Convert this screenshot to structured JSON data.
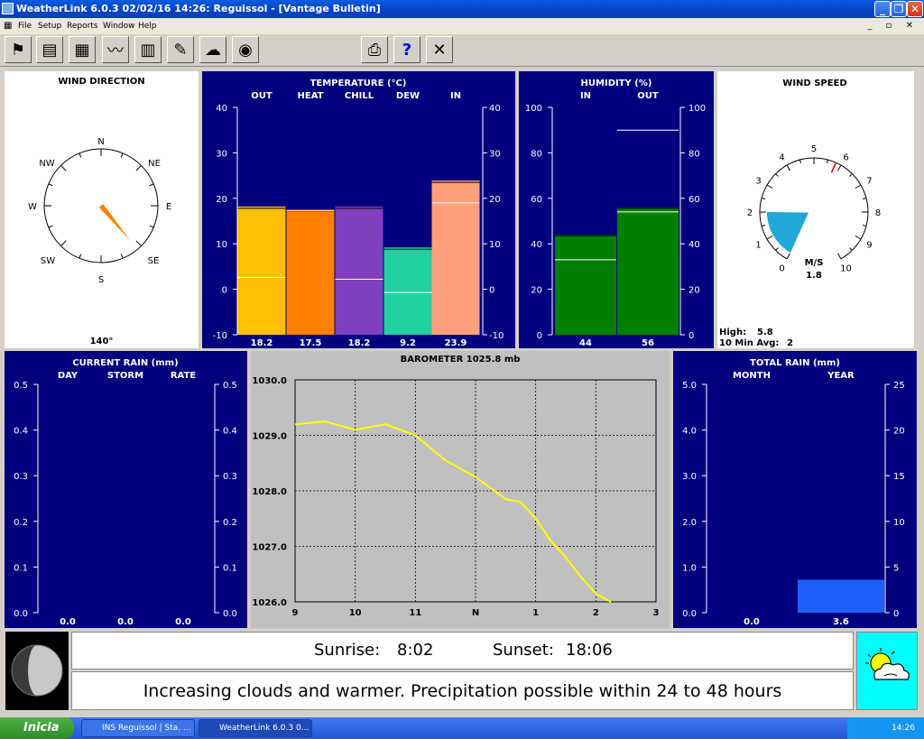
{
  "window": {
    "title": "WeatherLink 6.0.3  02/02/16  14:26: Reguissol - [Vantage Bulletin]"
  },
  "menu": [
    "File",
    "Setup",
    "Reports",
    "Window",
    "Help"
  ],
  "mdi_controls": "_ ▫ ✕",
  "toolbar": {
    "icons": [
      "bulletin-icon",
      "console-icon",
      "summary-icon",
      "graph-icon",
      "strip-chart-icon",
      "notes-icon",
      "weather-icon",
      "noaa-icon",
      "print-icon",
      "help-icon",
      "close-icon"
    ]
  },
  "wind_direction": {
    "title": "WIND DIRECTION",
    "degrees": 140,
    "degrees_label": "140°",
    "labels": [
      "N",
      "NE",
      "E",
      "SE",
      "S",
      "SW",
      "W",
      "NW"
    ],
    "needle_color": "#ff7f00"
  },
  "temperature": {
    "title": "TEMPERATURE  (°C)",
    "columns": [
      "OUT",
      "HEAT",
      "CHILL",
      "DEW",
      "IN"
    ],
    "values": [
      18.2,
      17.5,
      18.2,
      9.2,
      23.9
    ],
    "value_labels": [
      "18.2",
      "17.5",
      "18.2",
      "9.2",
      "23.9"
    ],
    "low_marks": [
      2.6,
      17.2,
      2.2,
      -0.7,
      19.0
    ],
    "colors": [
      "#ffc000",
      "#ff7f00",
      "#7f3fbf",
      "#20d0a0",
      "#ffa07a"
    ],
    "ticks": [
      "40",
      "30",
      "20",
      "10",
      "0",
      "-10"
    ],
    "ylim": [
      -10,
      40
    ]
  },
  "humidity": {
    "title": "HUMIDITY  (%)",
    "columns": [
      "IN",
      "OUT"
    ],
    "values": [
      44,
      56
    ],
    "value_labels": [
      "44",
      "56"
    ],
    "low_marks": [
      33,
      54
    ],
    "high_marks": [
      null,
      90
    ],
    "color": "#007f00",
    "ticks": [
      "100",
      "80",
      "60",
      "40",
      "20",
      "0"
    ],
    "ylim": [
      0,
      100
    ]
  },
  "wind_speed": {
    "title": "WIND SPEED",
    "unit": "M/S",
    "value": 1.8,
    "value_label": "1.8",
    "ticks": [
      "0",
      "1",
      "2",
      "3",
      "4",
      "5",
      "6",
      "7",
      "8",
      "9",
      "10"
    ],
    "high_label": "High:",
    "high_value": "5.8",
    "avg_label": "10 Min Avg:",
    "avg_value": "2",
    "range_low": 0.0,
    "range_high": 2.0,
    "red_mark": 5.8,
    "fill_color": "#1fa8d8"
  },
  "current_rain": {
    "title": "CURRENT RAIN  (mm)",
    "columns": [
      "DAY",
      "STORM",
      "RATE"
    ],
    "values": [
      "0.0",
      "0.0",
      "0.0"
    ],
    "ticks": [
      "0.5",
      "0.4",
      "0.3",
      "0.2",
      "0.1",
      "0.0"
    ]
  },
  "barometer": {
    "title": "BAROMETER 1025.8 mb",
    "ticks_y": [
      "1030.0",
      "1029.0",
      "1028.0",
      "1027.0",
      "1026.0"
    ],
    "ticks_x": [
      "9",
      "10",
      "11",
      "N",
      "1",
      "2",
      "3"
    ],
    "line_color": "#ffff00"
  },
  "total_rain": {
    "title": "TOTAL RAIN  (mm)",
    "columns": [
      "MONTH",
      "YEAR"
    ],
    "values": [
      "0.0",
      "3.6"
    ],
    "ticks_left": [
      "5.0",
      "4.0",
      "3.0",
      "2.0",
      "1.0",
      "0.0"
    ],
    "ticks_right": [
      "25",
      "20",
      "15",
      "10",
      "5",
      "0"
    ],
    "year_value": 3.6,
    "bar_color": "#2060ff"
  },
  "sun": {
    "sunrise_label": "Sunrise:",
    "sunrise": "8:02",
    "sunset_label": "Sunset:",
    "sunset": "18:06"
  },
  "forecast": {
    "text": "Increasing clouds and warmer.  Precipitation possible within 24 to 48 hours"
  },
  "chart_data": [
    {
      "type": "bar",
      "title": "TEMPERATURE  (°C)",
      "categories": [
        "OUT",
        "HEAT",
        "CHILL",
        "DEW",
        "IN"
      ],
      "values": [
        18.2,
        17.5,
        18.2,
        9.2,
        23.9
      ],
      "ylim": [
        -10,
        40
      ]
    },
    {
      "type": "bar",
      "title": "HUMIDITY  (%)",
      "categories": [
        "IN",
        "OUT"
      ],
      "values": [
        44,
        56
      ],
      "ylim": [
        0,
        100
      ]
    },
    {
      "type": "line",
      "title": "BAROMETER 1025.8 mb",
      "x": [
        9.0,
        9.5,
        10.0,
        10.5,
        11.0,
        11.5,
        12.0,
        12.5,
        12.75,
        13.0,
        13.25,
        13.5,
        13.75,
        14.0,
        14.25
      ],
      "x_tick_labels": [
        "9",
        "10",
        "11",
        "N",
        "1",
        "2",
        "3"
      ],
      "values": [
        1029.2,
        1029.25,
        1029.1,
        1029.2,
        1029.0,
        1028.55,
        1028.25,
        1027.85,
        1027.8,
        1027.5,
        1027.1,
        1026.8,
        1026.45,
        1026.15,
        1026.0
      ],
      "ylim": [
        1026.0,
        1030.0
      ],
      "xlim": [
        9,
        15
      ],
      "grid": true
    },
    {
      "type": "bar",
      "title": "TOTAL RAIN  (mm)",
      "categories": [
        "MONTH",
        "YEAR"
      ],
      "values": [
        0.0,
        3.6
      ],
      "ylim": [
        0,
        25
      ]
    }
  ],
  "taskbar": {
    "start": "Inicia",
    "tasks": [
      "INS Reguissol | Sta. ...",
      "WeatherLink 6.0.3  0..."
    ],
    "clock": "14:26"
  }
}
